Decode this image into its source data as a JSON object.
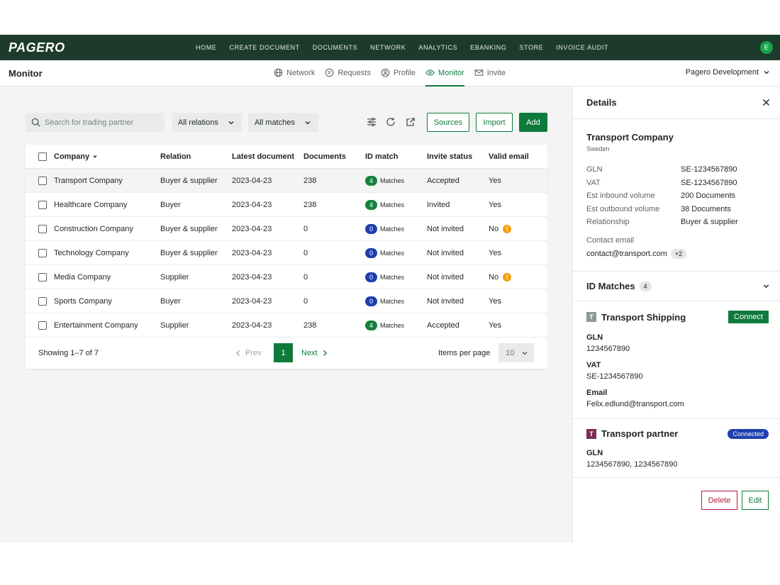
{
  "app": {
    "logo": "PAGERO",
    "nav": [
      "HOME",
      "CREATE DOCUMENT",
      "DOCUMENTS",
      "NETWORK",
      "ANALYTICS",
      "EBANKING",
      "STORE",
      "INVOICE AUDIT"
    ],
    "user_initial": "E"
  },
  "subnav": {
    "title": "Monitor",
    "tabs": [
      {
        "label": "Network",
        "icon": "globe-icon"
      },
      {
        "label": "Requests",
        "icon": "chat-icon"
      },
      {
        "label": "Profile",
        "icon": "user-circle-icon"
      },
      {
        "label": "Monitor",
        "icon": "eye-icon",
        "active": true
      },
      {
        "label": "Invite",
        "icon": "mail-icon"
      }
    ],
    "organization": "Pagero Development"
  },
  "toolbar": {
    "search_placeholder": "Search for trading partner",
    "relations_filter": "All relations",
    "matches_filter": "All matches",
    "sources_label": "Sources",
    "import_label": "Import",
    "add_label": "Add"
  },
  "table": {
    "columns": [
      "Company",
      "Relation",
      "Latest document",
      "Documents",
      "ID match",
      "Invite status",
      "Valid email"
    ],
    "match_suffix": "Matches",
    "rows": [
      {
        "company": "Transport Company",
        "relation": "Buyer & supplier",
        "latest": "2023-04-23",
        "documents": "238",
        "matches": "4",
        "invite": "Accepted",
        "email": "Yes",
        "warn": false,
        "selected": true
      },
      {
        "company": "Healthcare Company",
        "relation": "Buyer",
        "latest": "2023-04-23",
        "documents": "238",
        "matches": "4",
        "invite": "Invited",
        "email": "Yes",
        "warn": false,
        "selected": false
      },
      {
        "company": "Construction Company",
        "relation": "Buyer & supplier",
        "latest": "2023-04-23",
        "documents": "0",
        "matches": "0",
        "invite": "Not invited",
        "email": "No",
        "warn": true,
        "selected": false
      },
      {
        "company": "Technology Company",
        "relation": "Buyer & supplier",
        "latest": "2023-04-23",
        "documents": "0",
        "matches": "0",
        "invite": "Not invited",
        "email": "Yes",
        "warn": false,
        "selected": false
      },
      {
        "company": "Media Company",
        "relation": "Supplier",
        "latest": "2023-04-23",
        "documents": "0",
        "matches": "0",
        "invite": "Not invited",
        "email": "No",
        "warn": true,
        "selected": false
      },
      {
        "company": "Sports Company",
        "relation": "Buyer",
        "latest": "2023-04-23",
        "documents": "0",
        "matches": "0",
        "invite": "Not invited",
        "email": "Yes",
        "warn": false,
        "selected": false
      },
      {
        "company": "Entertainment Company",
        "relation": "Supplier",
        "latest": "2023-04-23",
        "documents": "238",
        "matches": "4",
        "invite": "Accepted",
        "email": "Yes",
        "warn": false,
        "selected": false
      }
    ],
    "showing": "Showing 1–7 of 7",
    "prev": "Prev",
    "page": "1",
    "next": "Next",
    "items_per_page_label": "Items per page",
    "items_per_page": "10"
  },
  "colors": {
    "brand_dark": "#1d3b2c",
    "accent_green": "#0f7a3c",
    "match_green": "#16803d",
    "match_blue": "#1e40af",
    "warn": "#f59e0b",
    "danger": "#b91c3c"
  },
  "details": {
    "title": "Details",
    "company": "Transport Company",
    "country": "Sweden",
    "fields": [
      {
        "k": "GLN",
        "v": "SE-1234567890"
      },
      {
        "k": "VAT",
        "v": "SE-1234567890"
      },
      {
        "k": "Est inbound volume",
        "v": "200 Documents"
      },
      {
        "k": "Est outbound volume",
        "v": "38 Documents"
      },
      {
        "k": "Relationship",
        "v": "Buyer & supplier"
      }
    ],
    "contact_label": "Contact email",
    "contact_email": "contact@transport.com",
    "contact_more": "+2",
    "id_matches_title": "ID Matches",
    "id_matches_count": "4",
    "matches": [
      {
        "initial": "T",
        "name": "Transport Shipping",
        "action": "Connect",
        "fields": [
          {
            "k": "GLN",
            "v": "1234567890"
          },
          {
            "k": "VAT",
            "v": "SE-1234567890"
          },
          {
            "k": "Email",
            "v": "Felix.edlund@transport.com"
          }
        ]
      },
      {
        "initial": "T",
        "name": "Transport partner",
        "badge": "Connected",
        "fields": [
          {
            "k": "GLN",
            "v": "1234567890, 1234567890"
          }
        ]
      }
    ],
    "delete_label": "Delete",
    "edit_label": "Edit"
  }
}
